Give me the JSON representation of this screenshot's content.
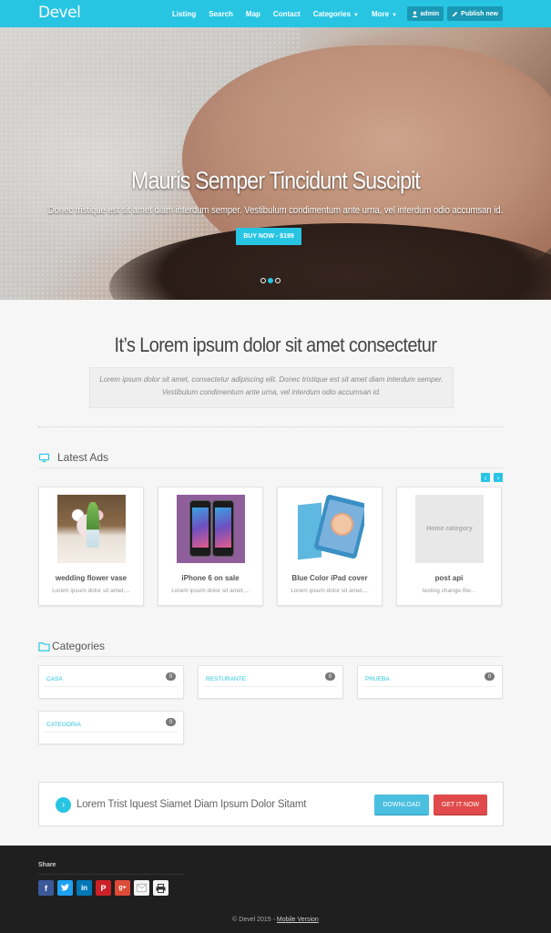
{
  "navbar": {
    "brand": "Devel",
    "links": [
      "Listing",
      "Search",
      "Map",
      "Contact",
      "Categories",
      "More"
    ],
    "user_button": "admin",
    "publish_button": "Publish new"
  },
  "hero": {
    "title": "Mauris Semper Tincidunt Suscipit",
    "subtitle": "Donec tristique est sit amet diam interdum semper. Vestibulum condimentum ante urna, vel interdum odio accumsan id.",
    "button": "BUY NOW - $199",
    "slides": 3,
    "active_slide": 2
  },
  "intro": {
    "title": "It’s Lorem ipsum dolor sit amet consectetur",
    "quote": "Lorem ipsum dolor sit amet, consectetur adipiscing elit. Donec tristique est sit amet diam interdum semper. Vestibulum condimentum ante urna, vel interdum odio accumsan id."
  },
  "latest_ads": {
    "heading": "Latest Ads",
    "items": [
      {
        "title": "wedding flower vase",
        "desc": "Lorem ipsum dolor sit amet,..."
      },
      {
        "title": "iPhone 6 on sale",
        "desc": "Lorem ipsum dolor sit amet,..."
      },
      {
        "title": "Blue Color iPad cover",
        "desc": "Lorem ipsum dolor sit amet,..."
      },
      {
        "title": "post api",
        "desc": "testing change the...",
        "placeholder": "Home category"
      }
    ]
  },
  "categories": {
    "heading": "Categories",
    "items": [
      {
        "name": "CASA",
        "count": "0"
      },
      {
        "name": "RESTURANTE",
        "count": "0"
      },
      {
        "name": "PRUEBA",
        "count": "0"
      },
      {
        "name": "CATEGORIA",
        "count": "0"
      }
    ]
  },
  "cta": {
    "text": "Lorem Trist Iquest Siamet Diam Ipsum Dolor Sitamt",
    "download": "DOWNLOAD",
    "get_it_now": "GET IT NOW"
  },
  "footer": {
    "share_label": "Share",
    "social": [
      "facebook",
      "twitter",
      "linkedin",
      "pinterest",
      "google-plus",
      "email",
      "print"
    ],
    "copyright": "© Devel 2015 -",
    "mobile_link": "Mobile Version"
  },
  "colors": {
    "accent": "#28c5e3",
    "danger": "#e04a4a",
    "footer_bg": "#1f1f1f"
  }
}
